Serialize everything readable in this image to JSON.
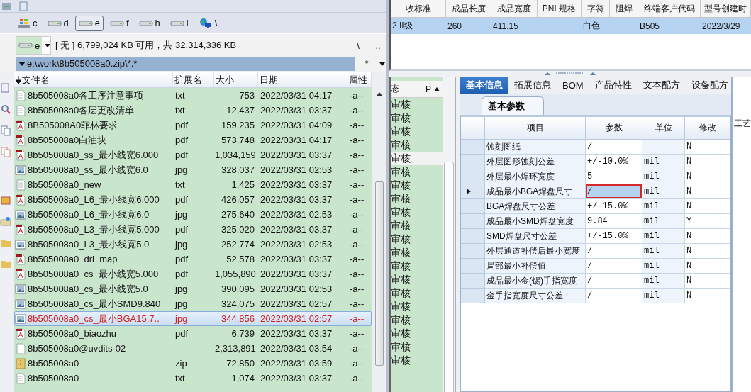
{
  "file_manager": {
    "drives": [
      {
        "letter": "c",
        "kind": "system",
        "selected": false
      },
      {
        "letter": "d",
        "kind": "drive",
        "selected": false
      },
      {
        "letter": "e",
        "kind": "drive",
        "selected": true
      },
      {
        "letter": "f",
        "kind": "drive",
        "selected": false
      },
      {
        "letter": "h",
        "kind": "drive",
        "selected": false
      },
      {
        "letter": "i",
        "kind": "drive",
        "selected": false
      },
      {
        "letter": "\\",
        "kind": "network",
        "selected": false
      }
    ],
    "drive_combo": "e",
    "free_space": "[ 无 ]  6,799,024 KB 可用，共 32,314,336 KB",
    "root_button": "\\",
    "up_button": "..",
    "path": "e:\\work\\8b505008a0.zip\\*.*",
    "filter": "*",
    "columns": [
      "文件名",
      "扩展名",
      "大小",
      "日期",
      "属性"
    ],
    "files": [
      {
        "name": "8b505008a0各工序注意事项",
        "ext": "txt",
        "size": "753",
        "date": "2022/03/31 04:17",
        "attr": "-a--",
        "kind": "text",
        "selected": false
      },
      {
        "name": "8b505008a0各层更改清单",
        "ext": "txt",
        "size": "12,437",
        "date": "2022/03/31 03:37",
        "attr": "-a--",
        "kind": "text",
        "selected": false
      },
      {
        "name": "8B505008A0菲林要求",
        "ext": "pdf",
        "size": "159,235",
        "date": "2022/03/31 04:09",
        "attr": "-a--",
        "kind": "pdf",
        "selected": false
      },
      {
        "name": "8b505008a0白油块",
        "ext": "pdf",
        "size": "573,748",
        "date": "2022/03/31 04:17",
        "attr": "-a--",
        "kind": "pdf",
        "selected": false
      },
      {
        "name": "8b505008a0_ss_最小线宽6.000",
        "ext": "pdf",
        "size": "1,034,159",
        "date": "2022/03/31 03:37",
        "attr": "-a--",
        "kind": "pdf",
        "selected": false
      },
      {
        "name": "8b505008a0_ss_最小线宽6.0",
        "ext": "jpg",
        "size": "328,037",
        "date": "2022/03/31 02:53",
        "attr": "-a--",
        "kind": "image",
        "selected": false
      },
      {
        "name": "8b505008a0_new",
        "ext": "txt",
        "size": "1,425",
        "date": "2022/03/31 03:37",
        "attr": "-a--",
        "kind": "text",
        "selected": false
      },
      {
        "name": "8b505008a0_L6_最小线宽6.000",
        "ext": "pdf",
        "size": "426,057",
        "date": "2022/03/31 03:37",
        "attr": "-a--",
        "kind": "pdf",
        "selected": false
      },
      {
        "name": "8b505008a0_L6_最小线宽6.0",
        "ext": "jpg",
        "size": "275,640",
        "date": "2022/03/31 02:53",
        "attr": "-a--",
        "kind": "image",
        "selected": false
      },
      {
        "name": "8b505008a0_L3_最小线宽5.000",
        "ext": "pdf",
        "size": "325,020",
        "date": "2022/03/31 03:37",
        "attr": "-a--",
        "kind": "pdf",
        "selected": false
      },
      {
        "name": "8b505008a0_L3_最小线宽5.0",
        "ext": "jpg",
        "size": "252,774",
        "date": "2022/03/31 02:53",
        "attr": "-a--",
        "kind": "image",
        "selected": false
      },
      {
        "name": "8b505008a0_drl_map",
        "ext": "pdf",
        "size": "52,578",
        "date": "2022/03/31 03:37",
        "attr": "-a--",
        "kind": "pdf",
        "selected": false
      },
      {
        "name": "8b505008a0_cs_最小线宽5.000",
        "ext": "pdf",
        "size": "1,055,890",
        "date": "2022/03/31 03:37",
        "attr": "-a--",
        "kind": "pdf",
        "selected": false
      },
      {
        "name": "8b505008a0_cs_最小线宽5.0",
        "ext": "jpg",
        "size": "390,095",
        "date": "2022/03/31 02:53",
        "attr": "-a--",
        "kind": "image",
        "selected": false
      },
      {
        "name": "8b505008a0_cs_最小SMD9.840",
        "ext": "jpg",
        "size": "324,075",
        "date": "2022/03/31 02:57",
        "attr": "-a--",
        "kind": "image",
        "selected": false
      },
      {
        "name": "8b505008a0_cs_最小BGA15.7..",
        "ext": "jpg",
        "size": "344,856",
        "date": "2022/03/31 02:57",
        "attr": "-a--",
        "kind": "image",
        "selected": true
      },
      {
        "name": "8b505008a0_biaozhu",
        "ext": "pdf",
        "size": "6,739",
        "date": "2022/03/31 03:37",
        "attr": "-a--",
        "kind": "pdf",
        "selected": false
      },
      {
        "name": "8b505008a0@uvdits-02",
        "size": "2,313,891",
        "date": "2022/03/31 03:54",
        "attr": "-a--",
        "kind": "file",
        "selected": false
      },
      {
        "name": "8b505008a0",
        "ext": "zip",
        "size": "72,850",
        "date": "2022/03/31 03:59",
        "attr": "-a--",
        "kind": "archive",
        "selected": false
      },
      {
        "name": "8b505008a0",
        "ext": "txt",
        "size": "1,074",
        "date": "2022/03/31 03:37",
        "attr": "-a--",
        "kind": "text",
        "selected": false
      }
    ]
  },
  "model_grid": {
    "columns": [
      "收标准",
      "成品长度",
      "成品宽度",
      "PNL规格",
      "字符",
      "阻焊",
      "终端客户代码",
      "型号创建时"
    ],
    "rows": [
      {
        "cells": [
          "2 II级",
          "260",
          "411.15",
          "",
          "白色",
          "",
          "B505",
          "2022/3/29"
        ],
        "selected": true
      }
    ]
  },
  "status_list": {
    "columns": [
      "态",
      "P"
    ],
    "rows": [
      {
        "text": "审核",
        "selected": false
      },
      {
        "text": "审核",
        "selected": false
      },
      {
        "text": "审核",
        "selected": false
      },
      {
        "text": "审核",
        "selected": false
      },
      {
        "text": "审核",
        "selected": true
      },
      {
        "text": "审核",
        "selected": false
      },
      {
        "text": "审核",
        "selected": false
      },
      {
        "text": "审核",
        "selected": false
      },
      {
        "text": "审核",
        "selected": false
      },
      {
        "text": "审核",
        "selected": false
      },
      {
        "text": "审核",
        "selected": false
      },
      {
        "text": "审核",
        "selected": false
      },
      {
        "text": "审核",
        "selected": false
      },
      {
        "text": "审核",
        "selected": false
      },
      {
        "text": "审核",
        "selected": false
      },
      {
        "text": "审核",
        "selected": false
      },
      {
        "text": "审核",
        "selected": false
      },
      {
        "text": "审核",
        "selected": false
      },
      {
        "text": "审核",
        "selected": false
      },
      {
        "text": "审核",
        "selected": false
      }
    ]
  },
  "tabs": [
    {
      "label": "基本信息",
      "selected": true
    },
    {
      "label": "拓展信息",
      "selected": false
    },
    {
      "label": "BOM",
      "selected": false
    },
    {
      "label": "产品特性",
      "selected": false
    },
    {
      "label": "文本配方",
      "selected": false
    },
    {
      "label": "设备配方",
      "selected": false
    }
  ],
  "sub_tab": "基本参数",
  "side_panel_label": "工艺",
  "params": {
    "columns": [
      "项目",
      "参数",
      "单位",
      "修改"
    ],
    "rows": [
      {
        "item": "蚀刻图纸",
        "value": "/",
        "unit": "",
        "modified": "N",
        "selected": false
      },
      {
        "item": "外层图形蚀刻公差",
        "value": "+/-10.0%",
        "unit": "mil",
        "modified": "N",
        "selected": false
      },
      {
        "item": "外层最小焊环宽度",
        "value": "5",
        "unit": "mil",
        "modified": "N",
        "selected": false
      },
      {
        "item": "成品最小BGA焊盘尺寸",
        "value": "/",
        "unit": "mil",
        "modified": "N",
        "selected": true
      },
      {
        "item": "BGA焊盘尺寸公差",
        "value": "+/-15.0%",
        "unit": "mil",
        "modified": "N",
        "selected": false
      },
      {
        "item": "成品最小SMD焊盘宽度",
        "value": "9.84",
        "unit": "mil",
        "modified": "Y",
        "selected": false
      },
      {
        "item": "SMD焊盘尺寸公差",
        "value": "+/-15.0%",
        "unit": "mil",
        "modified": "N",
        "selected": false
      },
      {
        "item": "外层通道补偿后最小宽度",
        "value": "/",
        "unit": "mil",
        "modified": "N",
        "selected": false
      },
      {
        "item": "局部最小补偿值",
        "value": "/",
        "unit": "mil",
        "modified": "N",
        "selected": false
      },
      {
        "item": "成品最小金(锡)手指宽度",
        "value": "/",
        "unit": "mil",
        "modified": "N",
        "selected": false
      },
      {
        "item": "金手指宽度尺寸公差",
        "value": "/",
        "unit": "mil",
        "modified": "N",
        "selected": false
      }
    ]
  }
}
